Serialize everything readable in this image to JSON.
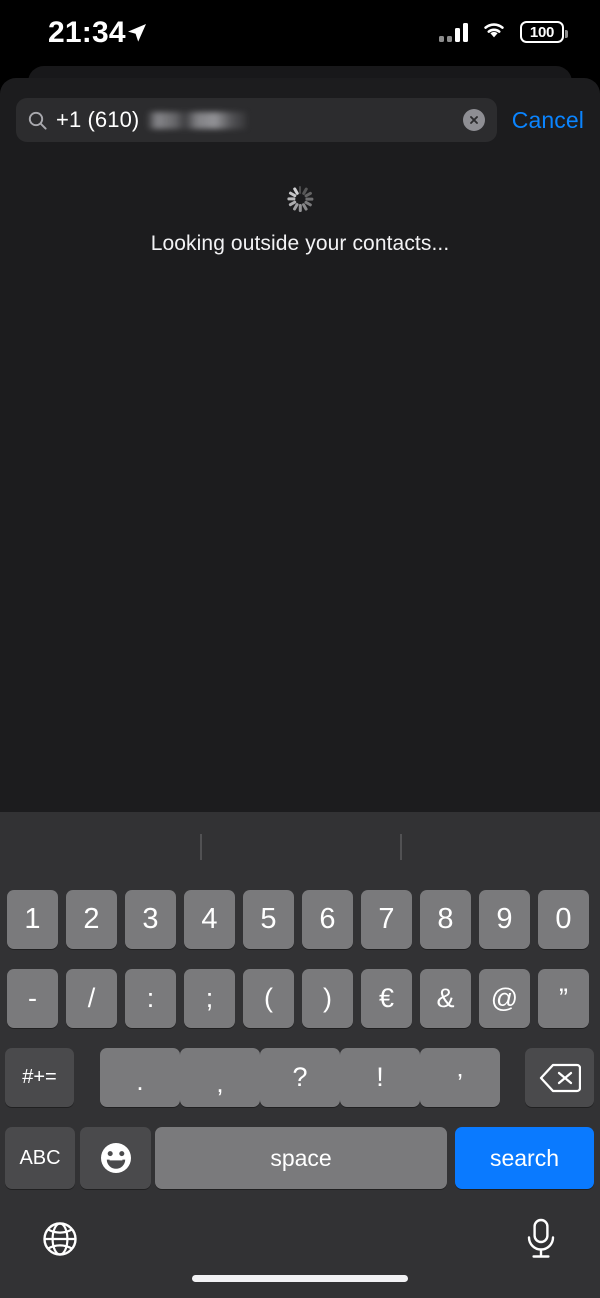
{
  "status_bar": {
    "time": "21:34",
    "location_icon": "location-arrow-icon",
    "cellular_icon": "cellular-bars-icon",
    "wifi_icon": "wifi-icon",
    "battery_level": "100"
  },
  "search": {
    "icon": "search-icon",
    "value": "+1 (610)",
    "redacted_suffix": true,
    "clear_icon": "clear-circle-icon",
    "cancel_label": "Cancel"
  },
  "content": {
    "spinner_icon": "loading-spinner-icon",
    "status_text": "Looking outside your contacts..."
  },
  "keyboard": {
    "layout": "numeric-symbols",
    "row1": [
      "1",
      "2",
      "3",
      "4",
      "5",
      "6",
      "7",
      "8",
      "9",
      "0"
    ],
    "row2": [
      "-",
      "/",
      ":",
      ";",
      "(",
      ")",
      "€",
      "&",
      "@",
      "”"
    ],
    "row3_shift_label": "#+=",
    "row3": [
      ".",
      ",",
      "?",
      "!",
      "’"
    ],
    "row3_backspace_icon": "backspace-icon",
    "bottom": {
      "abc_label": "ABC",
      "emoji_icon": "emoji-smiley-icon",
      "space_label": "space",
      "return_label": "search"
    },
    "globe_icon": "globe-icon",
    "dictation_icon": "microphone-icon"
  },
  "colors": {
    "accent_blue": "#0a7aff",
    "cancel_blue": "#0a84ff",
    "key_light": "#7a7a7c",
    "key_dark": "#4a4a4c",
    "keyboard_bg": "#323234",
    "sheet_bg": "#1c1c1e"
  },
  "home_indicator": "home-indicator"
}
